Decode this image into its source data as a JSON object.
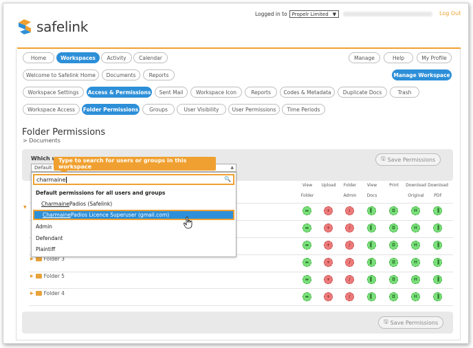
{
  "header": {
    "logo_text": "safelink",
    "logged_in_label": "Logged in to",
    "org_select": "Propelr Limited",
    "logout": "Log Out"
  },
  "nav_row1": {
    "left": [
      "Home",
      "Workspaces",
      "Activity",
      "Calendar"
    ],
    "right": [
      "Manage",
      "Help",
      "My Profile"
    ]
  },
  "nav_row2": {
    "left": [
      "Welcome to Safelink Home",
      "Documents",
      "Reports"
    ],
    "manage_workspace": "Manage Workspace"
  },
  "nav_row3": [
    "Workspace Settings",
    "Access & Permissions",
    "Sent Mail",
    "Workspace Icon",
    "Reports",
    "Codes & Metadata",
    "Duplicate Docs",
    "Trash"
  ],
  "nav_row4": [
    "Workspace Access",
    "Folder Permissions",
    "Groups",
    "User Visibility",
    "User Permissions",
    "Time Periods"
  ],
  "page": {
    "title": "Folder Permissions",
    "breadcrumb": "> Documents",
    "which_label": "Which u",
    "default_value": "Default",
    "save_label": "Save Permissions",
    "tooltip": "Type to search for users or groups in this workspace"
  },
  "dropdown": {
    "search_value": "charmaine",
    "items": [
      {
        "text": "Default permissions for all users and groups",
        "bold": true
      },
      {
        "name": "Charmaine",
        "rest": " Padios (Safelink)"
      },
      {
        "name": "Charmaine",
        "rest": " Padios Licence Superuser (gmail.com)"
      },
      {
        "text": "Admin"
      },
      {
        "text": "Defendant"
      },
      {
        "text": "Plaintiff"
      }
    ]
  },
  "table": {
    "columns": [
      {
        "l1": "View",
        "l2": "Folder"
      },
      {
        "l1": "Upload",
        "l2": ""
      },
      {
        "l1": "Folder",
        "l2": "Admin"
      },
      {
        "l1": "View",
        "l2": "Docs"
      },
      {
        "l1": "Print",
        "l2": ""
      },
      {
        "l1": "Download",
        "l2": "Original"
      },
      {
        "l1": "Download",
        "l2": "PDF"
      }
    ],
    "folders_visible": [
      "Folder 3",
      "Folder 5",
      "Folder 4"
    ],
    "icon_colors": [
      "green",
      "red",
      "red",
      "green",
      "green",
      "green",
      "green"
    ]
  },
  "colors": {
    "accent_orange": "#f0a030",
    "active_blue": "#2d8fd8",
    "allow_green": "#7be07b",
    "deny_red": "#ec7b7b"
  }
}
